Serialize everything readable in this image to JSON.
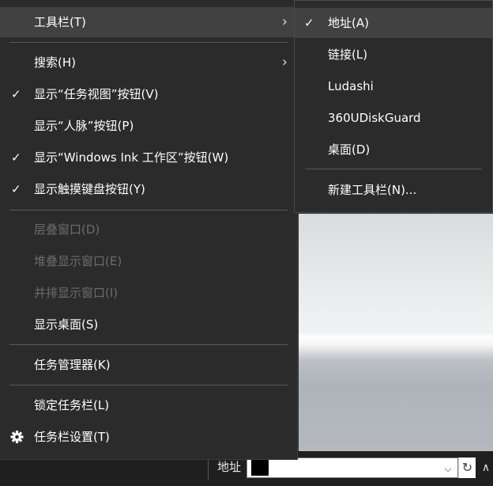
{
  "menu": {
    "toolbars": {
      "label": "工具栏(T)",
      "arrow": "›"
    },
    "search": {
      "label": "搜索(H)",
      "arrow": "›"
    },
    "task_view": {
      "label": "显示“任务视图”按钮(V)",
      "check": "✓"
    },
    "people": {
      "label": "显示“人脉”按钮(P)"
    },
    "ink": {
      "label": "显示“Windows Ink 工作区”按钮(W)",
      "check": "✓"
    },
    "touch_keyboard": {
      "label": "显示触摸键盘按钮(Y)",
      "check": "✓"
    },
    "cascade": {
      "label": "层叠窗口(D)"
    },
    "stacked": {
      "label": "堆叠显示窗口(E)"
    },
    "side_by_side": {
      "label": "并排显示窗口(I)"
    },
    "show_desktop": {
      "label": "显示桌面(S)"
    },
    "task_manager": {
      "label": "任务管理器(K)"
    },
    "lock_taskbar": {
      "label": "锁定任务栏(L)"
    },
    "taskbar_settings": {
      "label": "任务栏设置(T)",
      "icon": "gear-icon"
    }
  },
  "submenu": {
    "address": {
      "label": "地址(A)",
      "check": "✓"
    },
    "links": {
      "label": "链接(L)"
    },
    "ludashi": {
      "label": "Ludashi"
    },
    "usb_guard": {
      "label": "360UDiskGuard"
    },
    "desktop": {
      "label": "桌面(D)"
    },
    "new_toolbar": {
      "label": "新建工具栏(N)..."
    }
  },
  "taskbar": {
    "address_label": "地址",
    "dropdown": "⌵",
    "refresh": "↻",
    "tray_arrow": "∧"
  }
}
